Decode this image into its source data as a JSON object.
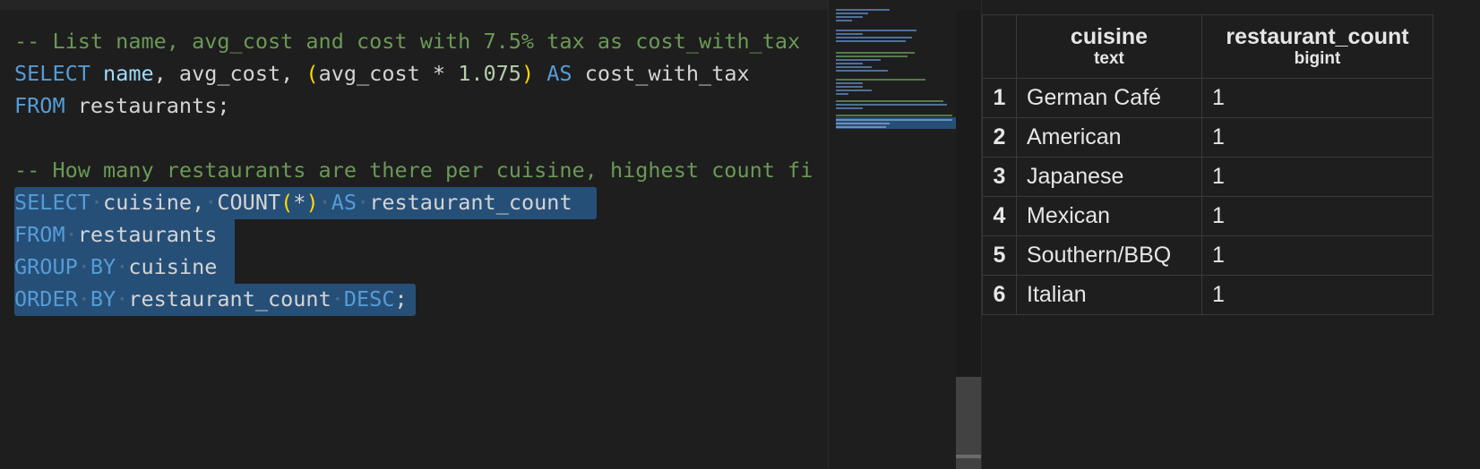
{
  "editor": {
    "lines": [
      {
        "tokens": [
          {
            "t": "-- List name, avg_cost and cost with 7.5% tax as cost_with_tax",
            "c": "cm"
          }
        ]
      },
      {
        "tokens": [
          {
            "t": "SELECT",
            "c": "kw"
          },
          {
            "t": " "
          },
          {
            "t": "name",
            "c": "id"
          },
          {
            "t": ", avg_cost, "
          },
          {
            "t": "(",
            "c": "br"
          },
          {
            "t": "avg_cost * "
          },
          {
            "t": "1.075",
            "c": "num"
          },
          {
            "t": ")",
            "c": "br"
          },
          {
            "t": " "
          },
          {
            "t": "AS",
            "c": "kw"
          },
          {
            "t": " cost_with_tax"
          }
        ]
      },
      {
        "tokens": [
          {
            "t": "FROM",
            "c": "kw"
          },
          {
            "t": " restaurants;"
          }
        ]
      },
      {
        "tokens": []
      },
      {
        "tokens": [
          {
            "t": "-- How many restaurants are there per cuisine, highest count fi",
            "c": "cm"
          }
        ]
      },
      {
        "tokens": [
          {
            "t": "SELECT",
            "c": "kw"
          },
          {
            "t": "·",
            "c": "ws"
          },
          {
            "t": "cuisine,"
          },
          {
            "t": "·",
            "c": "ws"
          },
          {
            "t": "COUNT"
          },
          {
            "t": "(",
            "c": "br"
          },
          {
            "t": "*"
          },
          {
            "t": ")",
            "c": "br"
          },
          {
            "t": "·",
            "c": "ws"
          },
          {
            "t": "AS",
            "c": "kw"
          },
          {
            "t": "·",
            "c": "ws"
          },
          {
            "t": "restaurant_count"
          }
        ]
      },
      {
        "tokens": [
          {
            "t": "FROM",
            "c": "kw"
          },
          {
            "t": "·",
            "c": "ws"
          },
          {
            "t": "restaurants"
          }
        ]
      },
      {
        "tokens": [
          {
            "t": "GROUP",
            "c": "kw"
          },
          {
            "t": "·",
            "c": "ws"
          },
          {
            "t": "BY",
            "c": "kw"
          },
          {
            "t": "·",
            "c": "ws"
          },
          {
            "t": "cuisine"
          }
        ]
      },
      {
        "tokens": [
          {
            "t": "ORDER",
            "c": "kw"
          },
          {
            "t": "·",
            "c": "ws"
          },
          {
            "t": "BY",
            "c": "kw"
          },
          {
            "t": "·",
            "c": "ws"
          },
          {
            "t": "restaurant_count"
          },
          {
            "t": "·",
            "c": "ws"
          },
          {
            "t": "DESC",
            "c": "kw"
          },
          {
            "t": ";"
          }
        ]
      }
    ]
  },
  "results": {
    "columns": [
      {
        "name": "cuisine",
        "type": "text"
      },
      {
        "name": "restaurant_count",
        "type": "bigint"
      }
    ],
    "rows": [
      {
        "n": "1",
        "cuisine": "German Café",
        "count": "1"
      },
      {
        "n": "2",
        "cuisine": "American",
        "count": "1"
      },
      {
        "n": "3",
        "cuisine": "Japanese",
        "count": "1"
      },
      {
        "n": "4",
        "cuisine": "Mexican",
        "count": "1"
      },
      {
        "n": "5",
        "cuisine": "Southern/BBQ",
        "count": "1"
      },
      {
        "n": "6",
        "cuisine": "Italian",
        "count": "1"
      }
    ]
  },
  "colors": {
    "keyword": "#569cd6",
    "comment": "#6a9955",
    "selection": "#264f78",
    "background": "#1e1e1e"
  }
}
